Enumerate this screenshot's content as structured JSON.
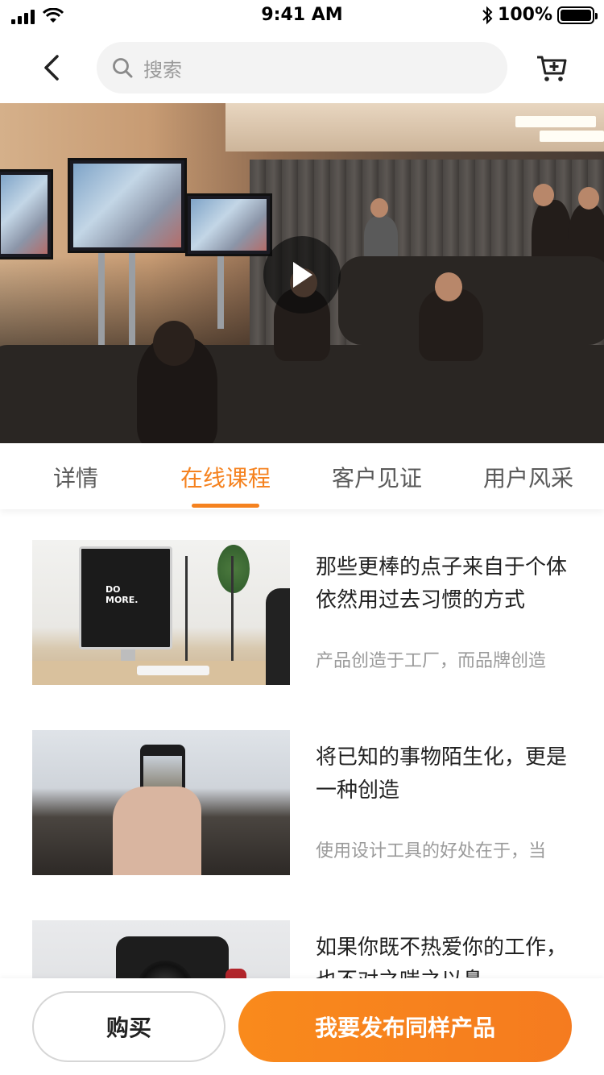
{
  "status_bar": {
    "time": "9:41 AM",
    "battery_text": "100%",
    "battery_level": 1.0
  },
  "nav": {
    "search_placeholder": "搜索",
    "back_icon": "chevron-left-icon",
    "cart_icon": "cart-add-icon"
  },
  "hero": {
    "play_icon": "play-icon"
  },
  "tabs": [
    {
      "label": "详情",
      "active": false
    },
    {
      "label": "在线课程",
      "active": true
    },
    {
      "label": "客户见证",
      "active": false
    },
    {
      "label": "用户风采",
      "active": false
    }
  ],
  "courses": [
    {
      "title": "那些更棒的点子来自于个体依然用过去习惯的方式",
      "desc": "产品创造于工厂，而品牌创造",
      "thumb_text": "DO\nMORE."
    },
    {
      "title": "将已知的事物陌生化，更是一种创造",
      "desc": "使用设计工具的好处在于，当"
    },
    {
      "title": "如果你既不热爱你的工作，也不对之嗤之以鼻",
      "desc": ""
    }
  ],
  "bottom": {
    "buy_label": "购买",
    "publish_label": "我要发布同样产品"
  },
  "colors": {
    "accent": "#f5821f",
    "publish_gradient_start": "#f98a1c",
    "publish_gradient_end": "#f57b1f",
    "text_primary": "#222222",
    "text_secondary": "#9a9a9a"
  }
}
